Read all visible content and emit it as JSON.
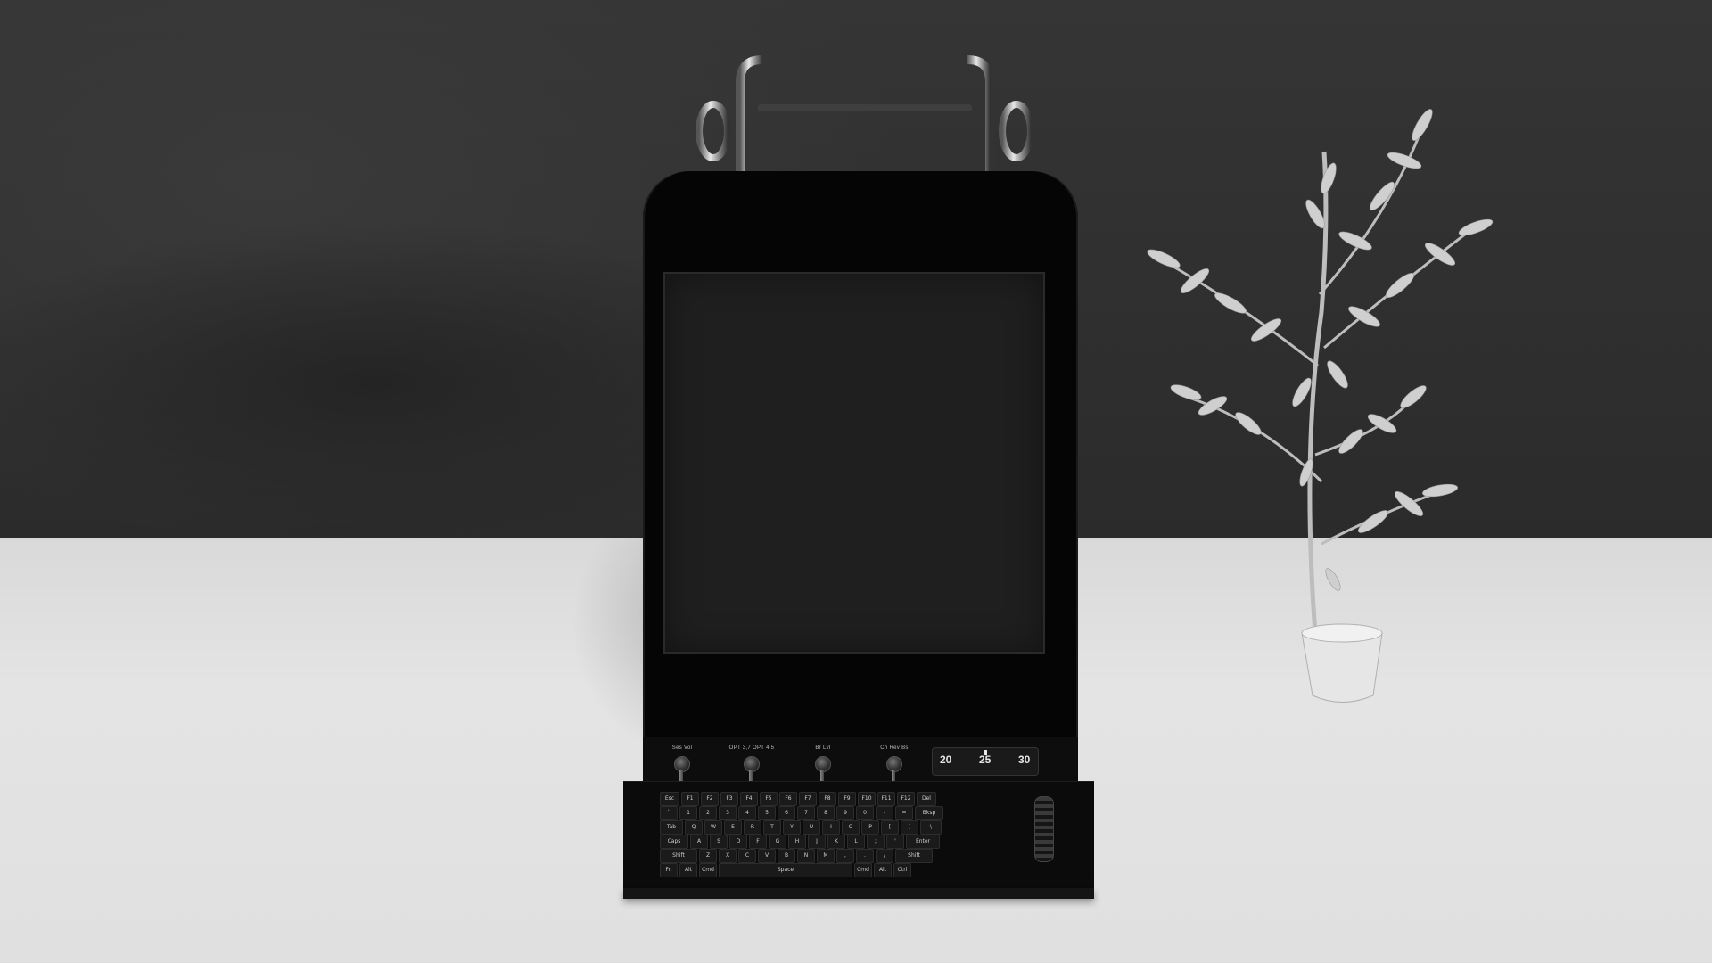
{
  "scene": {
    "object": "arcade-cabinet-computer",
    "icons": [
      "handle-icon",
      "plant-icon",
      "knob-icon",
      "scroll-wheel-icon"
    ]
  },
  "panel": {
    "knobs": [
      {
        "label": "Ses  Vol"
      },
      {
        "label": "OPT 3,7  OPT 4,5"
      },
      {
        "label": "Br    Lvl"
      },
      {
        "label": "Ch  Rev Bs"
      }
    ],
    "dial": {
      "left": "20",
      "center": "25",
      "right": "30"
    }
  },
  "keyboard": {
    "rows": [
      [
        "Esc",
        "F1",
        "F2",
        "F3",
        "F4",
        "F5",
        "F6",
        "F7",
        "F8",
        "F9",
        "F10",
        "F11",
        "F12",
        "Del"
      ],
      [
        "`",
        "1",
        "2",
        "3",
        "4",
        "5",
        "6",
        "7",
        "8",
        "9",
        "0",
        "-",
        "=",
        "Bksp"
      ],
      [
        "Tab",
        "Q",
        "W",
        "E",
        "R",
        "T",
        "Y",
        "U",
        "I",
        "O",
        "P",
        "[",
        "]",
        "\\"
      ],
      [
        "Caps",
        "A",
        "S",
        "D",
        "F",
        "G",
        "H",
        "J",
        "K",
        "L",
        ";",
        "'",
        "Enter"
      ],
      [
        "Shift",
        "Z",
        "X",
        "C",
        "V",
        "B",
        "N",
        "M",
        ",",
        ".",
        "/",
        "Shift"
      ],
      [
        "Fn",
        "Alt",
        "Cmd",
        "Space",
        "Cmd",
        "Alt",
        "Ctrl"
      ]
    ]
  }
}
